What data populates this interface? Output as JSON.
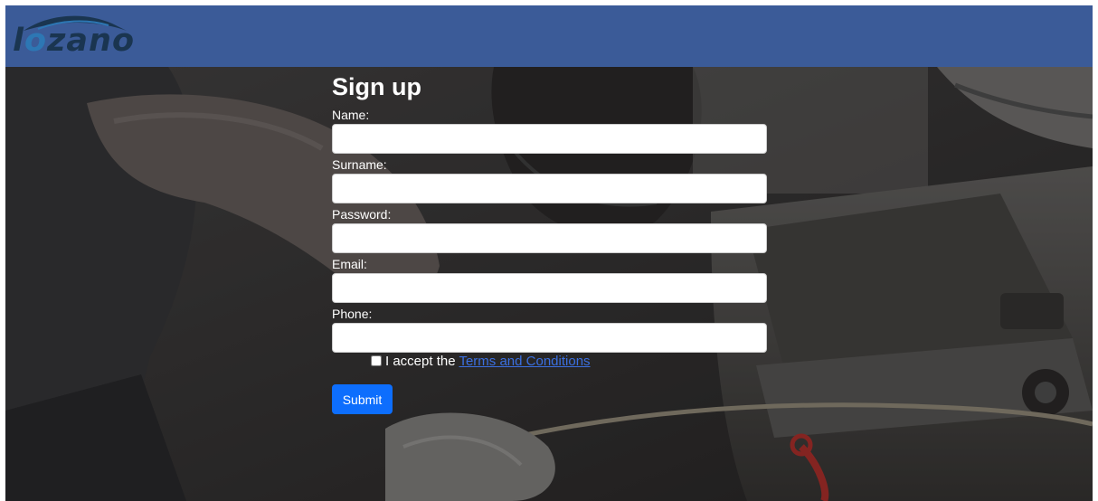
{
  "brand": {
    "logo_text": "lozano",
    "header_color": "#3b5b98",
    "logo_dark": "#1a3550",
    "logo_light": "#2d77b4"
  },
  "form": {
    "title": "Sign up",
    "fields": [
      {
        "label": "Name:",
        "value": "",
        "placeholder": ""
      },
      {
        "label": "Surname:",
        "value": "",
        "placeholder": ""
      },
      {
        "label": "Password:",
        "value": "",
        "placeholder": ""
      },
      {
        "label": "Email:",
        "value": "",
        "placeholder": ""
      },
      {
        "label": "Phone:",
        "value": "",
        "placeholder": ""
      }
    ],
    "terms_prefix": "I accept the",
    "terms_link": "Terms and Conditions",
    "submit_label": "Submit",
    "accent_color": "#0d6efd"
  },
  "background": {
    "description_icon": "mechanic-photo"
  }
}
